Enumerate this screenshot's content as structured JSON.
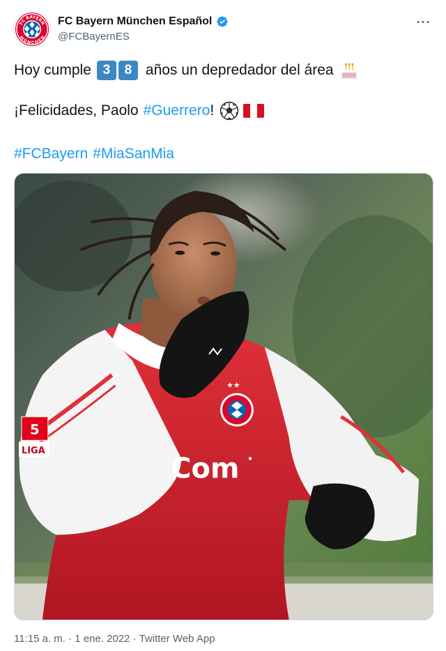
{
  "account": {
    "display_name": "FC Bayern München Español",
    "handle": "@FCBayernES",
    "verified": true,
    "avatar_icon": "fc-bayern-munchen-crest",
    "avatar_text_top": "FC BAYERN",
    "avatar_text_bottom": "MÜNCHEN"
  },
  "menu": {
    "more_icon": "more-horizontal-icon",
    "more_glyph": "···"
  },
  "tweet": {
    "line1": {
      "prefix": "Hoy cumple",
      "digit1": "3",
      "digit2": "8",
      "suffix": "años un depredador del área",
      "emoji": "birthday-cake"
    },
    "line2": {
      "prefix": "¡Felicidades, Paolo",
      "hashtag": "#Guerrero",
      "suffix": "!",
      "emoji1": "soccer-ball",
      "emoji2": "peru-flag"
    },
    "line3": {
      "hashtag1": "#FCBayern",
      "hashtag2": "#MiaSanMia"
    }
  },
  "media": {
    "description": "football-player-celebrating-photo",
    "sponsor_text": "Com",
    "sleeve_badge": "5",
    "sleeve_badge_text": "LIGA"
  },
  "meta": {
    "time": "11:15 a. m.",
    "separator": " · ",
    "date": "1 ene. 2022",
    "client": "Twitter Web App"
  },
  "colors": {
    "link": "#1d9bf0",
    "secondary_text": "#536471",
    "bayern_red": "#dc052d",
    "bayern_blue": "#0066b2",
    "keycap_blue": "#3b88c3",
    "peru_red": "#d91023"
  }
}
